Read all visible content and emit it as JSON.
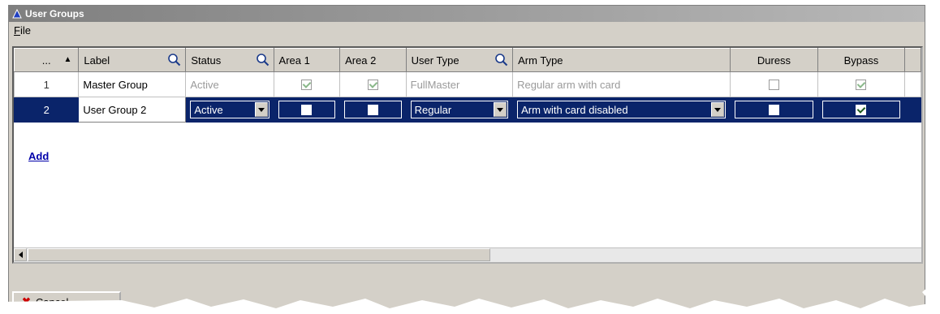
{
  "window": {
    "title": "User Groups"
  },
  "menu": {
    "file": "File",
    "file_accel": "F",
    "file_rest": "ile"
  },
  "columns": [
    "...",
    "Label",
    "Status",
    "Area 1",
    "Area 2",
    "User Type",
    "Arm Type",
    "Duress",
    "Bypass"
  ],
  "rows": [
    {
      "num": "1",
      "label": "Master Group",
      "status": "Active",
      "area1": true,
      "area2": true,
      "user_type": "FullMaster",
      "arm_type": "Regular arm with card",
      "duress": false,
      "bypass": true
    },
    {
      "num": "2",
      "label": "User Group 2",
      "status": "Active",
      "area1": false,
      "area2": false,
      "user_type": "Regular",
      "arm_type": "Arm with card disabled",
      "duress": false,
      "bypass": true
    }
  ],
  "add_link": "Add",
  "cancel_button": "Cancel",
  "colors": {
    "selection": "#0a246a",
    "face": "#d4d0c8",
    "link": "#0000aa"
  }
}
